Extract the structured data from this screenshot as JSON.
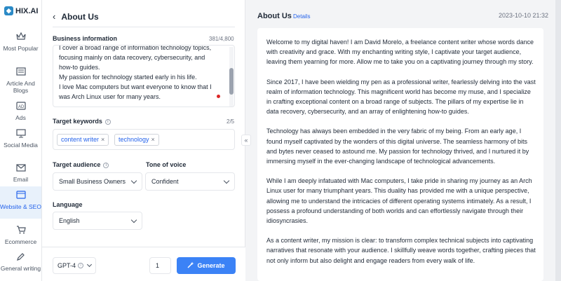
{
  "app": {
    "logo_text": "HIX.AI"
  },
  "sidebar": {
    "items": [
      {
        "label": "Most Popular",
        "icon": "crown-icon"
      },
      {
        "label": "Article And Blogs",
        "icon": "newspaper-icon"
      },
      {
        "label": "Ads",
        "icon": "ad-icon"
      },
      {
        "label": "Social Media",
        "icon": "monitor-icon"
      },
      {
        "label": "Email",
        "icon": "mail-icon"
      },
      {
        "label": "Website & SEO",
        "icon": "browser-icon",
        "active": true
      },
      {
        "label": "Ecommerce",
        "icon": "cart-icon"
      },
      {
        "label": "General writing",
        "icon": "pen-icon"
      }
    ]
  },
  "form": {
    "back_title": "About Us",
    "business_label": "Business information",
    "business_counter": "381/4,800",
    "business_lines": [
      "I cover a broad range of information technology topics,",
      "focusing mainly on data recovery, cybersecurity, and",
      "how-to guides.",
      "My passion for technology started early in his life.",
      "I love Mac computers but want everyone to know that I",
      "was Arch Linux user for many years."
    ],
    "keywords_label": "Target keywords",
    "keywords_counter": "2/5",
    "keywords": [
      "content writer",
      "technology"
    ],
    "audience_label": "Target audience",
    "audience_value": "Small Business Owners",
    "tone_label": "Tone of voice",
    "tone_value": "Confident",
    "language_label": "Language",
    "language_value": "English",
    "model_value": "GPT-4",
    "quantity": "1",
    "generate_label": "Generate"
  },
  "output": {
    "title": "About Us",
    "details_link": "Details",
    "date": "2023-10-10 21:32",
    "paragraphs": [
      "Welcome to my digital haven! I am David Morelo, a freelance content writer whose words dance with creativity and grace. With my enchanting writing style, I captivate your target audience, leaving them yearning for more. Allow me to take you on a captivating journey through my story.",
      "Since 2017, I have been wielding my pen as a professional writer, fearlessly delving into the vast realm of information technology. This magnificent world has become my muse, and I specialize in crafting exceptional content on a broad range of subjects. The pillars of my expertise lie in data recovery, cybersecurity, and an array of enlightening how-to guides.",
      "Technology has always been embedded in the very fabric of my being. From an early age, I found myself captivated by the wonders of this digital universe. The seamless harmony of bits and bytes never ceased to astound me. My passion for technology thrived, and I nurtured it by immersing myself in the ever-changing landscape of technological advancements.",
      "While I am deeply infatuated with Mac computers, I take pride in sharing my journey as an Arch Linux user for many triumphant years. This duality has provided me with a unique perspective, allowing me to understand the intricacies of different operating systems intimately. As a result, I possess a profound understanding of both worlds and can effortlessly navigate through their idiosyncrasies.",
      "As a content writer, my mission is clear: to transform complex technical subjects into captivating narratives that resonate with your audience. I skillfully weave words together, crafting pieces that not only inform but also delight and engage readers from every walk of life."
    ]
  },
  "colors": {
    "accent": "#3b82f6",
    "link": "#2563eb",
    "active_bg": "#e8f1fb"
  }
}
